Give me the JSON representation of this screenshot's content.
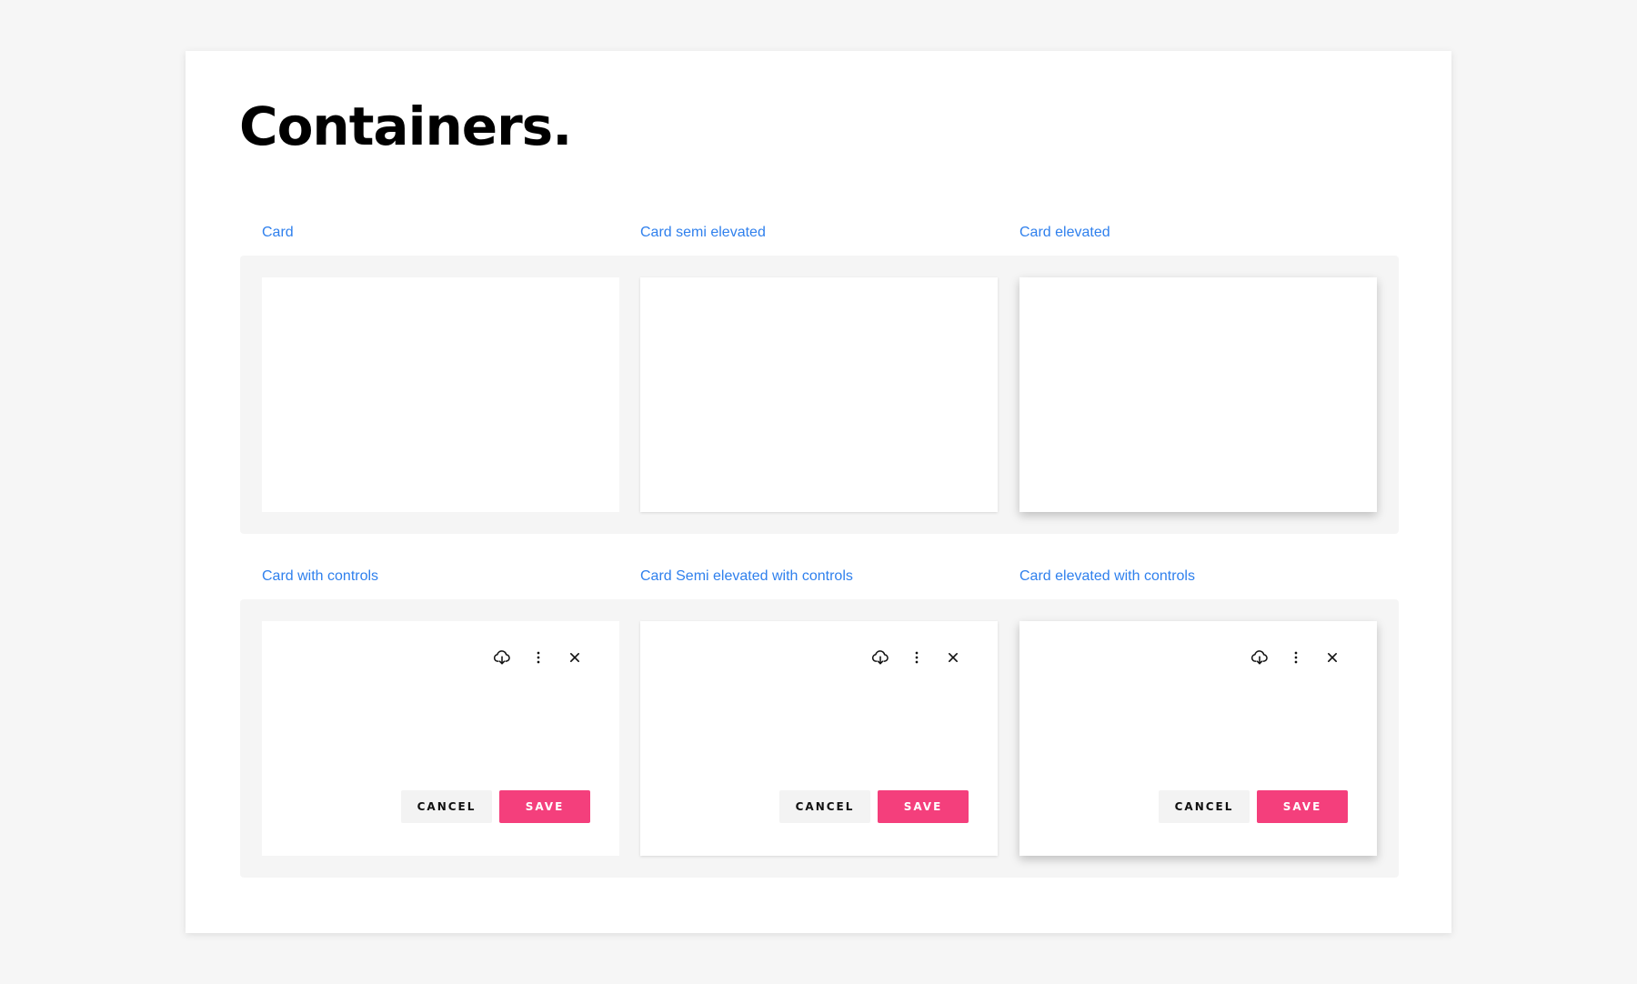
{
  "page": {
    "title": "Containers."
  },
  "colors": {
    "accent": "#2f80ed",
    "primary_button": "#f43f7c",
    "secondary_button": "#f3f3f3",
    "panel": "#f5f5f5"
  },
  "row1": {
    "labels": [
      "Card",
      "Card semi elevated",
      "Card elevated"
    ]
  },
  "row2": {
    "labels": [
      "Card with controls",
      "Card Semi elevated with controls",
      "Card elevated with controls"
    ]
  },
  "controls": {
    "icons": [
      "cloud-download-icon",
      "more-vert-icon",
      "close-icon"
    ],
    "cancel_label": "CANCEL",
    "save_label": "SAVE"
  }
}
